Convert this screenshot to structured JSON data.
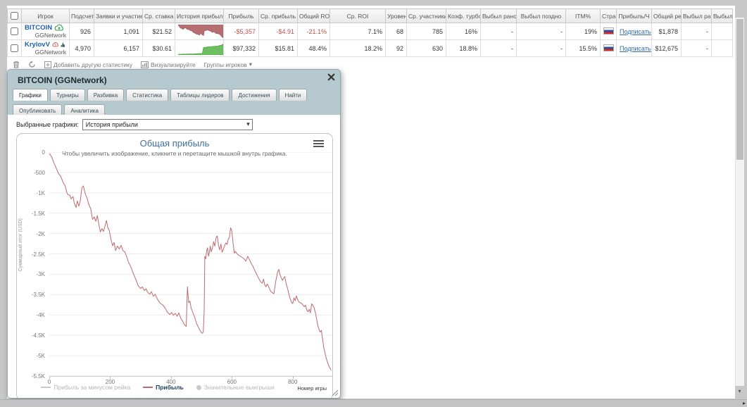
{
  "table": {
    "headers": [
      "Игрок",
      "Подсчет",
      "Заявки и участие",
      "Ср. ставка",
      "История прибыли",
      "Прибыль",
      "Ср. прибыль",
      "Общий ROI",
      "Ср. ROI",
      "Уровень",
      "Ср. участники",
      "Коэф. турбо",
      "Выбыл рано",
      "Выбыл поздно",
      "ITM%",
      "Стран",
      "Прибыль/Ч",
      "Общий рей",
      "Выбыл ран",
      "Выбыл"
    ],
    "rows": [
      {
        "player": "BITCOIN",
        "network": "GGNetwork",
        "icons": [
          "cloud-up-green"
        ],
        "cells": [
          {
            "v": "926"
          },
          {
            "v": "1,091"
          },
          {
            "v": "$21.52"
          },
          {
            "spark": "red"
          },
          {
            "v": "-$5,357",
            "neg": true
          },
          {
            "v": "-$4.91",
            "neg": true
          },
          {
            "v": "-21.1%",
            "neg": true
          },
          {
            "v": "7.1%"
          },
          {
            "v": "68"
          },
          {
            "v": "785"
          },
          {
            "v": "16%"
          },
          {
            "v": "-"
          },
          {
            "v": "-"
          },
          {
            "v": "19%"
          },
          {
            "flag": "ru"
          },
          {
            "link": "Подписаться"
          },
          {
            "v": "$1,878"
          },
          {
            "v": "-"
          },
          {
            "v": ""
          }
        ]
      },
      {
        "player": "KrylovV",
        "network": "GGNetwork",
        "icons": [
          "cloud-alert-red",
          "thumb-up"
        ],
        "cells": [
          {
            "v": "4,970"
          },
          {
            "v": "6,157"
          },
          {
            "v": "$30.61"
          },
          {
            "spark": "green"
          },
          {
            "v": "$97,332"
          },
          {
            "v": "$15.81"
          },
          {
            "v": "48.4%"
          },
          {
            "v": "18.2%"
          },
          {
            "v": "92"
          },
          {
            "v": "630"
          },
          {
            "v": "18.8%"
          },
          {
            "v": "-"
          },
          {
            "v": "-"
          },
          {
            "v": "15.5%"
          },
          {
            "flag": "ru"
          },
          {
            "link": "Подписаться"
          },
          {
            "v": "$12,675"
          },
          {
            "v": "-"
          },
          {
            "v": ""
          }
        ]
      }
    ],
    "toolbar": {
      "add_stat": "Добавить другую статистику",
      "visualize": "Визуализируйте",
      "groups": "Группы игроков"
    }
  },
  "popup": {
    "title": "BITCOIN (GGNetwork)",
    "tabs": [
      "Графики",
      "Турниры",
      "Разбивка",
      "Статистика",
      "Таблицы лидеров",
      "Достижения",
      "Найти",
      "Опубликовать",
      "Аналитика"
    ],
    "active_tab": "Графики",
    "selected_graphs_label": "Выбранные графики:",
    "graph_select_value": "История прибыли"
  },
  "icons": {
    "groups_caret": "▾",
    "select_caret": "▾",
    "vscroll_down": "▾",
    "hscroll_right": "▸"
  },
  "colors": {
    "negative": "#c0504d",
    "link": "#2e6bb0",
    "player_name": "#1d5fb3",
    "chart_line": "#c0686d",
    "spark_red_fill": "#b76e72",
    "spark_green_fill": "#6cc05f",
    "popup_header": "#b6c9ce",
    "chart_title": "#3c6e9f"
  },
  "sparklines": {
    "red": {
      "anchor": "top",
      "fill": "#b76e72",
      "stroke": "#a25d62",
      "values": [
        0.03,
        0.08,
        0.15,
        0.22,
        0.27,
        0.25,
        0.31,
        0.35,
        0.33,
        0.3,
        0.24,
        0.21,
        0.26,
        0.31,
        0.36,
        0.34,
        0.38,
        0.36,
        0.42,
        0.45,
        0.43,
        0.47,
        0.51,
        0.56,
        0.6,
        0.62,
        0.64,
        0.67,
        0.7,
        0.72,
        0.71,
        0.74,
        0.76,
        0.78,
        0.61,
        0.68,
        0.71,
        0.75,
        0.79,
        0.81,
        0.47,
        0.44,
        0.42,
        0.45,
        0.4,
        0.38,
        0.42,
        0.45,
        0.44,
        0.47,
        0.49,
        0.52,
        0.56,
        0.58,
        0.54,
        0.52,
        0.58,
        0.62,
        0.65,
        0.67,
        0.65,
        0.68,
        0.7,
        0.68,
        0.74,
        0.78,
        0.84,
        0.9,
        0.95,
        0.97
      ]
    },
    "green": {
      "anchor": "bottom",
      "fill": "#6cc05f",
      "stroke": "#53a24a",
      "values": [
        0.04,
        0.05,
        0.04,
        0.06,
        0.05,
        0.07,
        0.06,
        0.05,
        0.07,
        0.06,
        0.08,
        0.07,
        0.06,
        0.08,
        0.07,
        0.09,
        0.08,
        0.1,
        0.09,
        0.11,
        0.1,
        0.12,
        0.55,
        0.58,
        0.56,
        0.6,
        0.59,
        0.62,
        0.6,
        0.63,
        0.62,
        0.65,
        0.64,
        0.66,
        0.65,
        0.68,
        0.7,
        0.72,
        0.75,
        0.82
      ]
    }
  },
  "chart_data": {
    "type": "line",
    "title": "Общая прибыль",
    "subtitle": "Чтобы увеличить изображение, кликните и перетащите мышкой внутрь графика.",
    "xlabel": "Номер игры",
    "ylabel": "Суммарный итог (USD)",
    "xlim": [
      0,
      930
    ],
    "ylim": [
      -5500,
      0
    ],
    "xticks": [
      0,
      200,
      400,
      600,
      800
    ],
    "yticks": [
      "0",
      "-500",
      "-1K",
      "-1.5K",
      "-2K",
      "-2.5K",
      "-3K",
      "-3.5K",
      "-4K",
      "-4.5K",
      "-5K",
      "-5.5K"
    ],
    "grid": "horizontal",
    "legend": [
      {
        "label": "Прибыль за минусом рейка",
        "type": "line",
        "color": "#c9c9c9",
        "active": false
      },
      {
        "label": "Прибыль",
        "type": "line",
        "color": "#c0686d",
        "active": true
      },
      {
        "label": "Значительные выигрыши",
        "type": "circle",
        "color": "#c9c9c9",
        "active": false
      }
    ],
    "series": [
      {
        "name": "Прибыль",
        "color": "#c0686d",
        "points": [
          [
            0,
            -30
          ],
          [
            8,
            -120
          ],
          [
            15,
            -260
          ],
          [
            22,
            -380
          ],
          [
            30,
            -520
          ],
          [
            38,
            -600
          ],
          [
            45,
            -740
          ],
          [
            52,
            -830
          ],
          [
            58,
            -1000
          ],
          [
            62,
            -1050
          ],
          [
            68,
            -1060
          ],
          [
            72,
            -1150
          ],
          [
            78,
            -1090
          ],
          [
            82,
            -1250
          ],
          [
            88,
            -1360
          ],
          [
            92,
            -1200
          ],
          [
            97,
            -1330
          ],
          [
            102,
            -1190
          ],
          [
            107,
            -880
          ],
          [
            112,
            -830
          ],
          [
            118,
            -1020
          ],
          [
            124,
            -1130
          ],
          [
            130,
            -1290
          ],
          [
            136,
            -1390
          ],
          [
            142,
            -1650
          ],
          [
            148,
            -1590
          ],
          [
            153,
            -1700
          ],
          [
            158,
            -1560
          ],
          [
            163,
            -1780
          ],
          [
            168,
            -1960
          ],
          [
            173,
            -1880
          ],
          [
            178,
            -1950
          ],
          [
            183,
            -1820
          ],
          [
            188,
            -1680
          ],
          [
            192,
            -1850
          ],
          [
            197,
            -1920
          ],
          [
            203,
            -2150
          ],
          [
            208,
            -2300
          ],
          [
            213,
            -2220
          ],
          [
            218,
            -2420
          ],
          [
            224,
            -2310
          ],
          [
            230,
            -2380
          ],
          [
            236,
            -2290
          ],
          [
            242,
            -2420
          ],
          [
            248,
            -2450
          ],
          [
            254,
            -2560
          ],
          [
            260,
            -2700
          ],
          [
            268,
            -2820
          ],
          [
            276,
            -2980
          ],
          [
            284,
            -3120
          ],
          [
            292,
            -3280
          ],
          [
            300,
            -3350
          ],
          [
            306,
            -3310
          ],
          [
            312,
            -3400
          ],
          [
            318,
            -3360
          ],
          [
            324,
            -3450
          ],
          [
            330,
            -3490
          ],
          [
            336,
            -3430
          ],
          [
            342,
            -3540
          ],
          [
            348,
            -3490
          ],
          [
            356,
            -3620
          ],
          [
            364,
            -3710
          ],
          [
            372,
            -3750
          ],
          [
            380,
            -3820
          ],
          [
            388,
            -3930
          ],
          [
            396,
            -3990
          ],
          [
            402,
            -3940
          ],
          [
            408,
            -4010
          ],
          [
            414,
            -3960
          ],
          [
            420,
            -4030
          ],
          [
            426,
            -3950
          ],
          [
            432,
            -4080
          ],
          [
            438,
            -4150
          ],
          [
            444,
            -4240
          ],
          [
            450,
            -4280
          ],
          [
            454,
            -3310
          ],
          [
            458,
            -3700
          ],
          [
            462,
            -3660
          ],
          [
            466,
            -3830
          ],
          [
            472,
            -3950
          ],
          [
            478,
            -4060
          ],
          [
            484,
            -4210
          ],
          [
            490,
            -4300
          ],
          [
            496,
            -4390
          ],
          [
            502,
            -4450
          ],
          [
            506,
            -4420
          ],
          [
            509,
            -3900
          ],
          [
            511,
            -2560
          ],
          [
            514,
            -2620
          ],
          [
            517,
            -2430
          ],
          [
            520,
            -2350
          ],
          [
            523,
            -2560
          ],
          [
            526,
            -2470
          ],
          [
            529,
            -2310
          ],
          [
            532,
            -2450
          ],
          [
            536,
            -2360
          ],
          [
            540,
            -2200
          ],
          [
            544,
            -2310
          ],
          [
            548,
            -2100
          ],
          [
            552,
            -2060
          ],
          [
            556,
            -2290
          ],
          [
            560,
            -2400
          ],
          [
            564,
            -2260
          ],
          [
            568,
            -2460
          ],
          [
            572,
            -2390
          ],
          [
            576,
            -2300
          ],
          [
            580,
            -2230
          ],
          [
            584,
            -2270
          ],
          [
            588,
            -2140
          ],
          [
            592,
            -2090
          ],
          [
            596,
            -1860
          ],
          [
            600,
            -1950
          ],
          [
            604,
            -2240
          ],
          [
            608,
            -2480
          ],
          [
            612,
            -2440
          ],
          [
            616,
            -2490
          ],
          [
            622,
            -2530
          ],
          [
            628,
            -2560
          ],
          [
            634,
            -2590
          ],
          [
            640,
            -2620
          ],
          [
            646,
            -2680
          ],
          [
            652,
            -2560
          ],
          [
            658,
            -2650
          ],
          [
            664,
            -2740
          ],
          [
            670,
            -2820
          ],
          [
            676,
            -2920
          ],
          [
            682,
            -3010
          ],
          [
            688,
            -3100
          ],
          [
            694,
            -3180
          ],
          [
            700,
            -3220
          ],
          [
            704,
            -3120
          ],
          [
            708,
            -3260
          ],
          [
            712,
            -3310
          ],
          [
            716,
            -3240
          ],
          [
            720,
            -3290
          ],
          [
            726,
            -3400
          ],
          [
            732,
            -3450
          ],
          [
            738,
            -3480
          ],
          [
            744,
            -3180
          ],
          [
            750,
            -2950
          ],
          [
            754,
            -2880
          ],
          [
            758,
            -3010
          ],
          [
            762,
            -3080
          ],
          [
            766,
            -3150
          ],
          [
            770,
            -3100
          ],
          [
            774,
            -3060
          ],
          [
            778,
            -3220
          ],
          [
            784,
            -3380
          ],
          [
            790,
            -3570
          ],
          [
            796,
            -3690
          ],
          [
            800,
            -3720
          ],
          [
            804,
            -3580
          ],
          [
            808,
            -3650
          ],
          [
            812,
            -3530
          ],
          [
            816,
            -3620
          ],
          [
            820,
            -3680
          ],
          [
            826,
            -3700
          ],
          [
            832,
            -3740
          ],
          [
            838,
            -3800
          ],
          [
            842,
            -3760
          ],
          [
            846,
            -3880
          ],
          [
            850,
            -3920
          ],
          [
            854,
            -3860
          ],
          [
            858,
            -3950
          ],
          [
            862,
            -3730
          ],
          [
            866,
            -3760
          ],
          [
            870,
            -3820
          ],
          [
            874,
            -3930
          ],
          [
            878,
            -4080
          ],
          [
            882,
            -4250
          ],
          [
            886,
            -4350
          ],
          [
            890,
            -4420
          ],
          [
            894,
            -4380
          ],
          [
            898,
            -4590
          ],
          [
            902,
            -4800
          ],
          [
            906,
            -4940
          ],
          [
            910,
            -5060
          ],
          [
            914,
            -5160
          ],
          [
            918,
            -5240
          ],
          [
            922,
            -5300
          ],
          [
            926,
            -5357
          ]
        ]
      }
    ]
  }
}
